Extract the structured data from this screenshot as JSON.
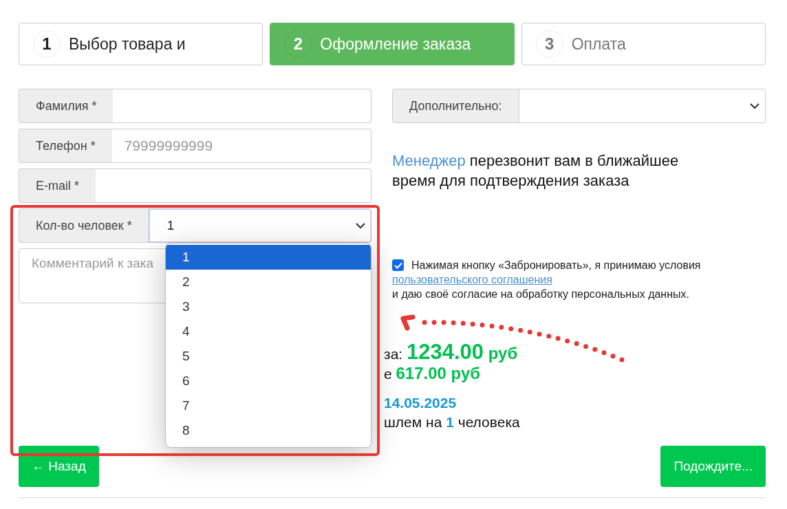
{
  "steps": [
    {
      "number": "1",
      "label": "Выбор товара и",
      "selected": false
    },
    {
      "number": "2",
      "label": "Оформление заказа",
      "selected": true
    },
    {
      "number": "3",
      "label": "Оплата",
      "selected": false
    }
  ],
  "fields": [
    {
      "kind": "text",
      "label": "Фамилия *"
    },
    {
      "kind": "text",
      "label": "Телефон *",
      "placeholder": "79999999999"
    },
    {
      "kind": "text",
      "label": "E-mail *"
    },
    {
      "kind": "select",
      "label": "Кол-во человек *",
      "value": "1",
      "expanded": true
    }
  ],
  "comment": {
    "placeholder": "Комментарий к зака"
  },
  "options": [
    {
      "label": "1",
      "selected": true
    },
    {
      "label": "2",
      "selected": false
    },
    {
      "label": "3",
      "selected": false
    },
    {
      "label": "4",
      "selected": false
    },
    {
      "label": "5",
      "selected": false
    },
    {
      "label": "6",
      "selected": false
    },
    {
      "label": "7",
      "selected": false
    },
    {
      "label": "8",
      "selected": false
    }
  ],
  "extra": {
    "label": "Дополнительно:"
  },
  "manager_note": {
    "highlight": "Менеджер",
    "text": " перезвонит вам в ближайшее время для подтверждения заказа"
  },
  "consent": {
    "checked": true,
    "text_before": "Нажимая кнопку «Забронировать», я принимаю условия",
    "link": "пользовательского соглашения",
    "text_after": "и даю своё согласие на обработку персональных данных."
  },
  "summary": [
    {
      "parts": [
        {
          "text": "за: ",
          "kind": "plain"
        },
        {
          "text": "1234.00",
          "kind": "big"
        },
        {
          "text": " руб",
          "kind": "accent"
        }
      ]
    },
    {
      "parts": [
        {
          "text": "е ",
          "kind": "plain"
        },
        {
          "text": "617.00 руб",
          "kind": "accent"
        }
      ]
    },
    {
      "parts": [
        {
          "text": "14.05.2025",
          "kind": "info"
        }
      ]
    },
    {
      "parts": [
        {
          "text": "шлем на ",
          "kind": "plain"
        },
        {
          "text": "1",
          "kind": "info"
        },
        {
          "text": " человека",
          "kind": "plain"
        }
      ]
    }
  ],
  "buttons": {
    "back": "← Назад",
    "submit": "Подождите..."
  }
}
